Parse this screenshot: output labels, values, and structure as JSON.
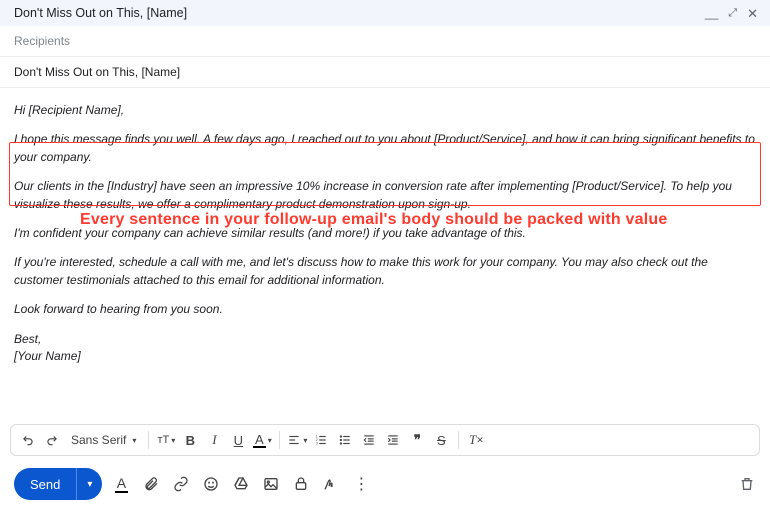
{
  "window": {
    "title": "Don't Miss Out on This, [Name]"
  },
  "recipients": {
    "placeholder": "Recipients"
  },
  "subject": {
    "value": "Don't Miss Out on This, [Name]"
  },
  "body": {
    "greeting": "Hi [Recipient Name],",
    "p1": "I hope this message finds you well. A few days ago, I reached out to you about [Product/Service], and how it can bring significant benefits to your company.",
    "p2": "Our clients in the [Industry] have seen an impressive 10% increase in conversion rate after implementing [Product/Service]. To help you visualize these results, we offer a complimentary product demonstration upon sign-up.",
    "p3": "I'm confident your company can achieve similar results (and more!) if you take advantage of this.",
    "p4": "If you're interested, schedule a call with me, and let's discuss how to make this work for your company. You may also check out the customer testimonials attached to this email for additional information.",
    "p5": "Look forward to hearing from you soon.",
    "closing": "Best,",
    "signature": "[Your Name]"
  },
  "annotation": {
    "text": "Every sentence in your follow-up email's body should be packed with value"
  },
  "format_toolbar": {
    "font": "Sans Serif"
  },
  "bottom_toolbar": {
    "send": "Send"
  }
}
